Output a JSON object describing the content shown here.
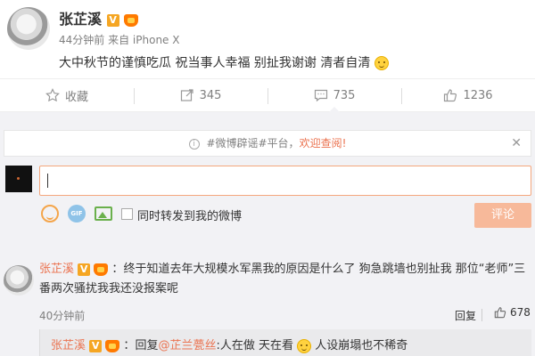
{
  "post": {
    "author": "张芷溪",
    "badge_v": "V",
    "time": "44分钟前",
    "source": "来自 iPhone X",
    "text": "大中秋节的谨慎吃瓜 祝当事人幸福 别扯我谢谢 清者自清"
  },
  "actions": [
    {
      "label": "收藏",
      "icon": "star-icon"
    },
    {
      "label": "345",
      "icon": "share-icon"
    },
    {
      "label": "735",
      "icon": "comment-icon"
    },
    {
      "label": "1236",
      "icon": "like-icon"
    }
  ],
  "notice": {
    "hint": "#微博辟谣#平台，",
    "welcome": "欢迎查阅!"
  },
  "composer": {
    "input_value": "",
    "repost_label": "同时转发到我的微博",
    "submit_label": "评论",
    "gif_label": "GIF"
  },
  "comment": {
    "author": "张芷溪",
    "badge_v": "V",
    "text": "终于知道去年大规模水军黑我的原因是什么了 狗急跳墙也别扯我 那位“老师”三番两次骚扰我我还没报案呢",
    "time": "40分钟前",
    "reply_label": "回复",
    "likes": "678"
  },
  "sub_reply": {
    "author": "张芷溪",
    "badge_v": "V",
    "prefix": "回复",
    "mention": "@芷兰甍丝",
    "text_a": ":人在做 天在看",
    "text_b": " 人设崩塌也不稀奇"
  },
  "colors": {
    "accent": "#eb7350",
    "submit_disabled": "#f7b99a",
    "badge": "#f5a623"
  }
}
